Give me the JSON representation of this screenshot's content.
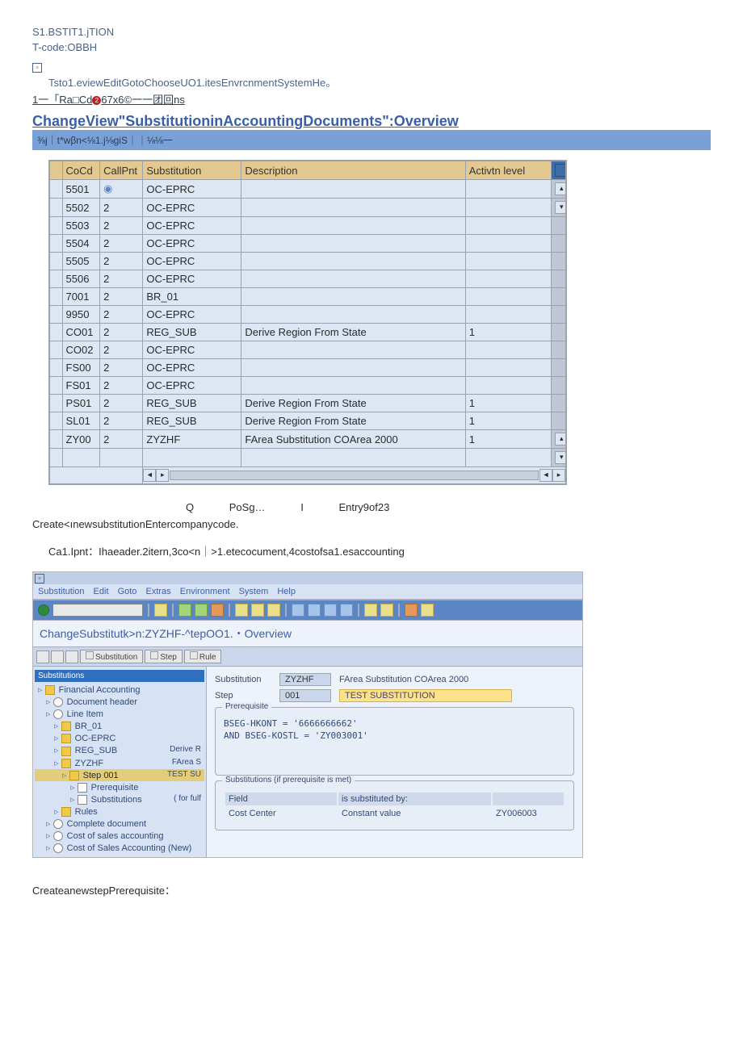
{
  "header": {
    "line1": "S1.BSTIT1.jTION",
    "tcode": "T-code:OBBH",
    "box_char": "▫",
    "menu": "Tsto1.eviewEditGotoChooseUO1.itesEnvrcnmentSystemHe。",
    "breadcrumb_pre": "1一「Ra□Cd",
    "breadcrumb_num": "2",
    "breadcrumb_post": "67x6©一一团回ns",
    "title": "ChangeView\"SubstitutioninAccountingDocuments\":Overview",
    "subbar": "⅜j｜t*wβn<⅛1.j⅛giS｜｜⅛⅛一"
  },
  "table1": {
    "columns": {
      "cocd": "CoCd",
      "call": "CallPnt",
      "sub": "Substitution",
      "desc": "Description",
      "act": "Activtn level"
    },
    "rows": [
      {
        "cocd": "5501",
        "call": "",
        "sub": "OC-EPRC",
        "desc": "",
        "act": "",
        "btn": true
      },
      {
        "cocd": "5502",
        "call": "2",
        "sub": "OC-EPRC",
        "desc": "",
        "act": ""
      },
      {
        "cocd": "5503",
        "call": "2",
        "sub": "OC-EPRC",
        "desc": "",
        "act": ""
      },
      {
        "cocd": "5504",
        "call": "2",
        "sub": "OC-EPRC",
        "desc": "",
        "act": ""
      },
      {
        "cocd": "5505",
        "call": "2",
        "sub": "OC-EPRC",
        "desc": "",
        "act": ""
      },
      {
        "cocd": "5506",
        "call": "2",
        "sub": "OC-EPRC",
        "desc": "",
        "act": ""
      },
      {
        "cocd": "7001",
        "call": "2",
        "sub": "BR_01",
        "desc": "",
        "act": ""
      },
      {
        "cocd": "9950",
        "call": "2",
        "sub": "OC-EPRC",
        "desc": "",
        "act": ""
      },
      {
        "cocd": "CO01",
        "call": "2",
        "sub": "REG_SUB",
        "desc": "Derive Region From State",
        "act": "1"
      },
      {
        "cocd": "CO02",
        "call": "2",
        "sub": "OC-EPRC",
        "desc": "",
        "act": ""
      },
      {
        "cocd": "FS00",
        "call": "2",
        "sub": "OC-EPRC",
        "desc": "",
        "act": ""
      },
      {
        "cocd": "FS01",
        "call": "2",
        "sub": "OC-EPRC",
        "desc": "",
        "act": ""
      },
      {
        "cocd": "PS01",
        "call": "2",
        "sub": "REG_SUB",
        "desc": "Derive Region From State",
        "act": "1"
      },
      {
        "cocd": "SL01",
        "call": "2",
        "sub": "REG_SUB",
        "desc": "Derive Region From State",
        "act": "1"
      },
      {
        "cocd": "ZY00",
        "call": "2",
        "sub": "ZYZHF",
        "desc": "FArea Substitution COArea 2000",
        "act": "1"
      },
      {
        "cocd": "",
        "call": "",
        "sub": "",
        "desc": "",
        "act": ""
      }
    ]
  },
  "status": {
    "q": "Q",
    "posg": "PoSg…",
    "l": "I",
    "entry": "Entry9of23"
  },
  "text1": "Create<ınewsubstitutionEntercompanycode.",
  "text2": "Ca1.Ipnt：Ihaeader.2itern,3co<n｜>1.etecocument,4costofsa1.esaccounting",
  "panel2": {
    "menu": [
      "Substitution",
      "Edit",
      "Goto",
      "Extras",
      "Environment",
      "System",
      "Help"
    ],
    "title": "ChangeSubstitutk>n:ZYZHF-^tepOO1.・Overview",
    "tabs": {
      "sub": "Substitution",
      "step": "Step",
      "rule": "Rule"
    },
    "tree": {
      "header": "Substitutions",
      "items": [
        {
          "lvl": 0,
          "ic": "folder",
          "label": "Financial Accounting"
        },
        {
          "lvl": 1,
          "ic": "clock",
          "label": "Document header"
        },
        {
          "lvl": 1,
          "ic": "clock",
          "label": "Line Item"
        },
        {
          "lvl": 2,
          "ic": "folder",
          "label": "BR_01"
        },
        {
          "lvl": 2,
          "ic": "folder",
          "label": "OC-EPRC"
        },
        {
          "lvl": 2,
          "ic": "folder",
          "label": "REG_SUB",
          "right": "Derive R"
        },
        {
          "lvl": 2,
          "ic": "folder",
          "label": "ZYZHF",
          "right": "FArea S"
        },
        {
          "lvl": 3,
          "ic": "folder",
          "label": "Step 001",
          "right": "TEST SU",
          "sel": true
        },
        {
          "lvl": 4,
          "ic": "flag",
          "label": "Prerequisite"
        },
        {
          "lvl": 4,
          "ic": "flag",
          "label": "Substitutions",
          "right": "( for fulf"
        },
        {
          "lvl": 2,
          "ic": "folder",
          "label": "Rules"
        },
        {
          "lvl": 1,
          "ic": "clock",
          "label": "Complete document"
        },
        {
          "lvl": 1,
          "ic": "clock",
          "label": "Cost of sales accounting"
        },
        {
          "lvl": 1,
          "ic": "clock",
          "label": "Cost of Sales Accounting (New)"
        }
      ]
    },
    "main": {
      "sub_label": "Substitution",
      "sub_val": "ZYZHF",
      "sub_desc": "FArea Substitution COArea 2000",
      "step_label": "Step",
      "step_val": "001",
      "step_desc": "TEST SUBSTITUTION",
      "prereq_title": "Prerequisite",
      "cond1": "BSEG-HKONT = '6666666662'",
      "cond2": "AND BSEG-KOSTL = 'ZY003001'",
      "subs_title": "Substitutions (if prerequisite is met)",
      "col_field": "Field",
      "col_sub": "is substituted by:",
      "row_field": "Cost Center",
      "row_sub": "Constant value",
      "row_val": "ZY006003"
    }
  },
  "footer": "CreateanewstepPrerequisite："
}
